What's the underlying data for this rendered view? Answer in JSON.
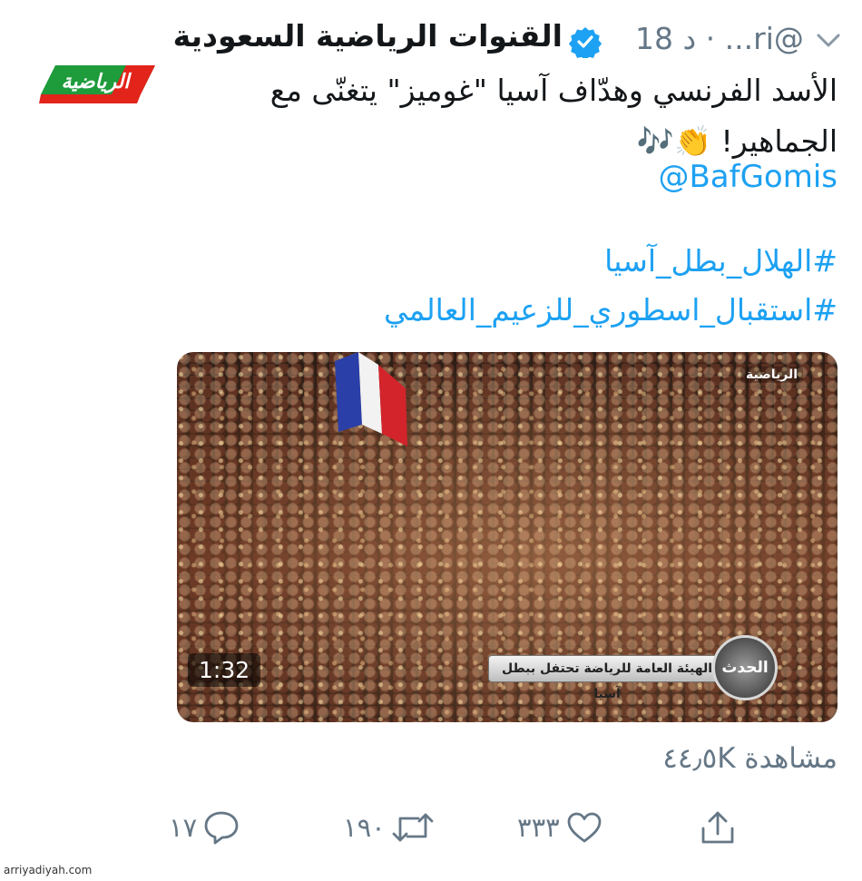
{
  "header": {
    "display_name": "القنوات الرياضية السعودية",
    "handle_time": "18 د · ...ri@"
  },
  "logo": {
    "text": "الرياضية"
  },
  "tweet": {
    "text": "الأسد الفرنسي وهدّاف آسيا \"غوميز\" يتغنّى مع الجماهير! 👏🎶",
    "mention": "@BafGomis",
    "hashtags": [
      "#الهلال_بطل_آسيا",
      "#استقبال_اسطوري_للزعيم_العالمي"
    ]
  },
  "media": {
    "duration": "1:32",
    "channel_watermark": "الرياضية",
    "news_ticker": "الهيئة العامة للرياضة تحتفل ببطل آسيا",
    "news_emblem": "الحدث"
  },
  "views": "مشاهدة ٤٤٫٥K",
  "actions": {
    "reply_count": "١٧",
    "retweet_count": "١٩٠",
    "like_count": "٣٣٣"
  },
  "footer": {
    "site_credit": "arriyadiyah.com"
  },
  "colors": {
    "link": "#1da1f2",
    "secondary": "#657786",
    "logo_green": "#1e9b3b",
    "logo_red": "#e2241b"
  }
}
